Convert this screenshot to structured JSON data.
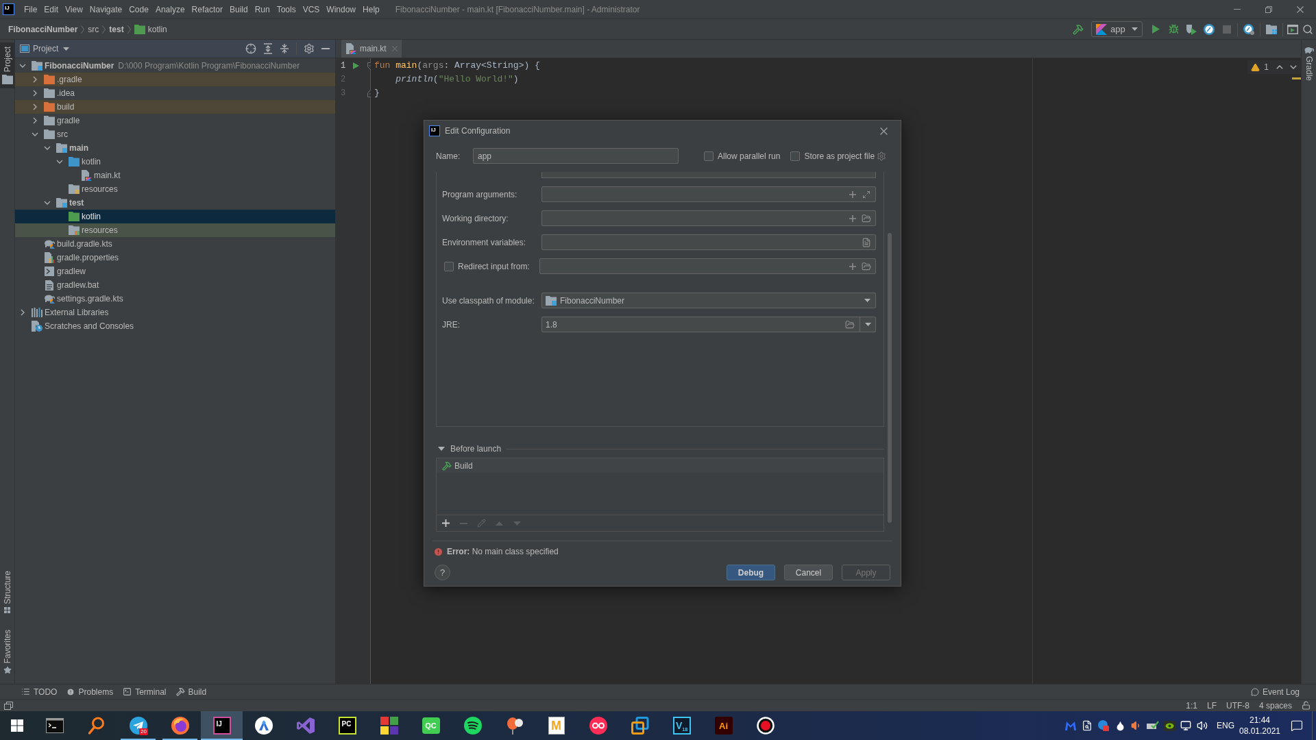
{
  "window": {
    "app_logo": "IJ",
    "title": "FibonacciNumber - main.kt [FibonacciNumber.main] - Administrator"
  },
  "menu": [
    "File",
    "Edit",
    "View",
    "Navigate",
    "Code",
    "Analyze",
    "Refactor",
    "Build",
    "Run",
    "Tools",
    "VCS",
    "Window",
    "Help"
  ],
  "breadcrumbs": [
    {
      "label": "FibonacciNumber",
      "kind": "module"
    },
    {
      "label": "src",
      "kind": "folder"
    },
    {
      "label": "test",
      "kind": "module"
    },
    {
      "label": "kotlin",
      "kind": "test_root"
    }
  ],
  "run_config": {
    "label": "app"
  },
  "left_stripe": {
    "top": [
      {
        "label": "Project",
        "selected": true
      }
    ],
    "bottom": [
      {
        "label": "Structure",
        "selected": false
      },
      {
        "label": "Favorites",
        "selected": false
      }
    ]
  },
  "project_panel": {
    "title": "Project",
    "tree": [
      {
        "label": "FibonacciNumber",
        "path": "D:\\000 Program\\Kotlin Program\\FibonacciNumber",
        "kind": "module",
        "expanded": true,
        "selected": false,
        "children": [
          {
            "label": ".gradle",
            "kind": "excluded_folder",
            "expanded": false,
            "selected": false,
            "color": "#4e4636"
          },
          {
            "label": ".idea",
            "kind": "folder",
            "expanded": false,
            "selected": false
          },
          {
            "label": "build",
            "kind": "excluded_folder",
            "expanded": false,
            "selected": false,
            "color": "#4e4636"
          },
          {
            "label": "gradle",
            "kind": "folder",
            "expanded": false,
            "selected": false
          },
          {
            "label": "src",
            "kind": "folder",
            "expanded": true,
            "selected": false,
            "children": [
              {
                "label": "main",
                "kind": "module_folder",
                "expanded": true,
                "selected": false,
                "children": [
                  {
                    "label": "kotlin",
                    "kind": "source_root",
                    "expanded": true,
                    "selected": false,
                    "children": [
                      {
                        "label": "main.kt",
                        "kind": "kotlin_file",
                        "selected": false
                      }
                    ]
                  },
                  {
                    "label": "resources",
                    "kind": "resources_root",
                    "selected": false
                  }
                ]
              },
              {
                "label": "test",
                "kind": "module_folder",
                "expanded": true,
                "selected": false,
                "children": [
                  {
                    "label": "kotlin",
                    "kind": "test_root",
                    "selected": true
                  },
                  {
                    "label": "resources",
                    "kind": "test_resources_root",
                    "selected": false,
                    "color": "#495348"
                  }
                ]
              }
            ]
          },
          {
            "label": "build.gradle.kts",
            "kind": "gradle_script",
            "selected": false
          },
          {
            "label": "gradle.properties",
            "kind": "properties_file",
            "selected": false
          },
          {
            "label": "gradlew",
            "kind": "shell_script",
            "selected": false
          },
          {
            "label": "gradlew.bat",
            "kind": "batch_file",
            "selected": false
          },
          {
            "label": "settings.gradle.kts",
            "kind": "gradle_script",
            "selected": false
          }
        ]
      },
      {
        "label": "External Libraries",
        "kind": "libraries",
        "expanded": false,
        "selected": false
      },
      {
        "label": "Scratches and Consoles",
        "kind": "scratches",
        "selected": false
      }
    ]
  },
  "editor": {
    "tabs": [
      {
        "label": "main.kt",
        "selected": true
      }
    ],
    "lines": [
      {
        "number": "1",
        "current": true,
        "run_marker": true,
        "fold_start": true,
        "fold_end": false,
        "tokens": [
          {
            "kind": "keyword",
            "text": "fun"
          },
          {
            "kind": "function",
            "text": " main"
          },
          {
            "kind": "plain",
            "text": "("
          },
          {
            "kind": "unused",
            "text": "args"
          },
          {
            "kind": "plain",
            "text": ": Array<String>) {"
          }
        ]
      },
      {
        "number": "2",
        "current": false,
        "run_marker": false,
        "fold_start": false,
        "fold_end": false,
        "tokens": [
          {
            "kind": "call",
            "text": "    println"
          },
          {
            "kind": "plain",
            "text": "("
          },
          {
            "kind": "string",
            "text": "\"Hello World!\""
          },
          {
            "kind": "plain",
            "text": ")"
          }
        ]
      },
      {
        "number": "3",
        "current": false,
        "run_marker": false,
        "fold_start": false,
        "fold_end": true,
        "tokens": [
          {
            "kind": "plain",
            "text": "}"
          }
        ]
      }
    ],
    "warnings": "1"
  },
  "right_stripe": [
    {
      "label": "Gradle",
      "selected": false
    }
  ],
  "dialog": {
    "logo": "IJ",
    "title": "Edit Configuration",
    "name": {
      "label": "Name:",
      "value": "app"
    },
    "options": [
      {
        "label": "Allow parallel run",
        "checked": false
      },
      {
        "label": "Store as project file",
        "checked": false
      }
    ],
    "fields": [
      {
        "kind": "arguments",
        "label": "Program arguments:"
      },
      {
        "kind": "directory",
        "label": "Working directory:"
      },
      {
        "kind": "environment",
        "label": "Environment variables:"
      },
      {
        "kind": "redirect",
        "label": "Redirect input from:",
        "checked": false
      },
      {
        "kind": "module",
        "label": "Use classpath of module:",
        "value": "FibonacciNumber"
      },
      {
        "kind": "jre",
        "label": "JRE:",
        "value": "1.8"
      }
    ],
    "before_launch": {
      "label": "Before launch",
      "expanded": true,
      "tasks": [
        {
          "label": "Build",
          "selected": true
        }
      ],
      "toolbar": [
        {
          "kind": "add",
          "disabled": false
        },
        {
          "kind": "remove",
          "disabled": true
        },
        {
          "kind": "edit",
          "disabled": true
        },
        {
          "kind": "up",
          "disabled": true
        },
        {
          "kind": "down",
          "disabled": true
        }
      ]
    },
    "error": "**Error:** No main class specified",
    "help": "?",
    "buttons": [
      {
        "label": "Debug",
        "kind": "primary",
        "disabled": false
      },
      {
        "label": "Cancel",
        "kind": "secondary",
        "disabled": false
      },
      {
        "label": "Apply",
        "kind": "secondary",
        "disabled": true
      }
    ]
  },
  "tool_windows": [
    {
      "label": "TODO",
      "kind": "todo"
    },
    {
      "label": "Problems",
      "kind": "problems"
    },
    {
      "label": "Terminal",
      "kind": "terminal"
    },
    {
      "label": "Build",
      "kind": "build"
    }
  ],
  "event_log": "Event Log",
  "status_bar": [
    "1:1",
    "LF",
    "UTF-8",
    "4 spaces"
  ],
  "taskbar": {
    "apps": [
      {
        "kind": "terminal",
        "running": false,
        "selected": false
      },
      {
        "kind": "magnifier",
        "running": false,
        "selected": false
      },
      {
        "kind": "paper_plane",
        "running": true,
        "selected": false,
        "badge": "20"
      },
      {
        "kind": "fox",
        "running": true,
        "selected": false
      },
      {
        "kind": "ij_tile",
        "running": true,
        "selected": true,
        "glyph": "IJ"
      },
      {
        "kind": "person_circle",
        "running": false,
        "selected": false
      },
      {
        "kind": "ribbon",
        "running": false,
        "selected": false
      },
      {
        "kind": "pc_tile",
        "running": false,
        "selected": false,
        "glyph": "PC"
      },
      {
        "kind": "color_tiles",
        "running": false,
        "selected": false
      },
      {
        "kind": "qc_tile",
        "running": false,
        "selected": false,
        "glyph": "QC"
      },
      {
        "kind": "waves_circle",
        "running": false,
        "selected": false
      },
      {
        "kind": "balloon",
        "running": false,
        "selected": false
      },
      {
        "kind": "m_tile",
        "running": false,
        "selected": false,
        "glyph": "M"
      },
      {
        "kind": "rings_circle",
        "running": false,
        "selected": false
      },
      {
        "kind": "squares",
        "running": false,
        "selected": false
      },
      {
        "kind": "v_tile",
        "running": false,
        "selected": false,
        "glyph": "V",
        "sub": "18"
      },
      {
        "kind": "ai_tile",
        "running": false,
        "selected": false,
        "glyph": "Ai"
      },
      {
        "kind": "record",
        "running": false,
        "selected": false
      }
    ],
    "tray": {
      "icons": [
        {
          "kind": "wing"
        },
        {
          "kind": "doc_search"
        },
        {
          "kind": "badge_circle"
        },
        {
          "kind": "drop"
        },
        {
          "kind": "speaker"
        },
        {
          "kind": "drive_check"
        },
        {
          "kind": "eye_logo"
        },
        {
          "kind": "network"
        },
        {
          "kind": "volume"
        }
      ],
      "language": "ENG",
      "time": "21:44",
      "date": "08.01.2021"
    }
  }
}
